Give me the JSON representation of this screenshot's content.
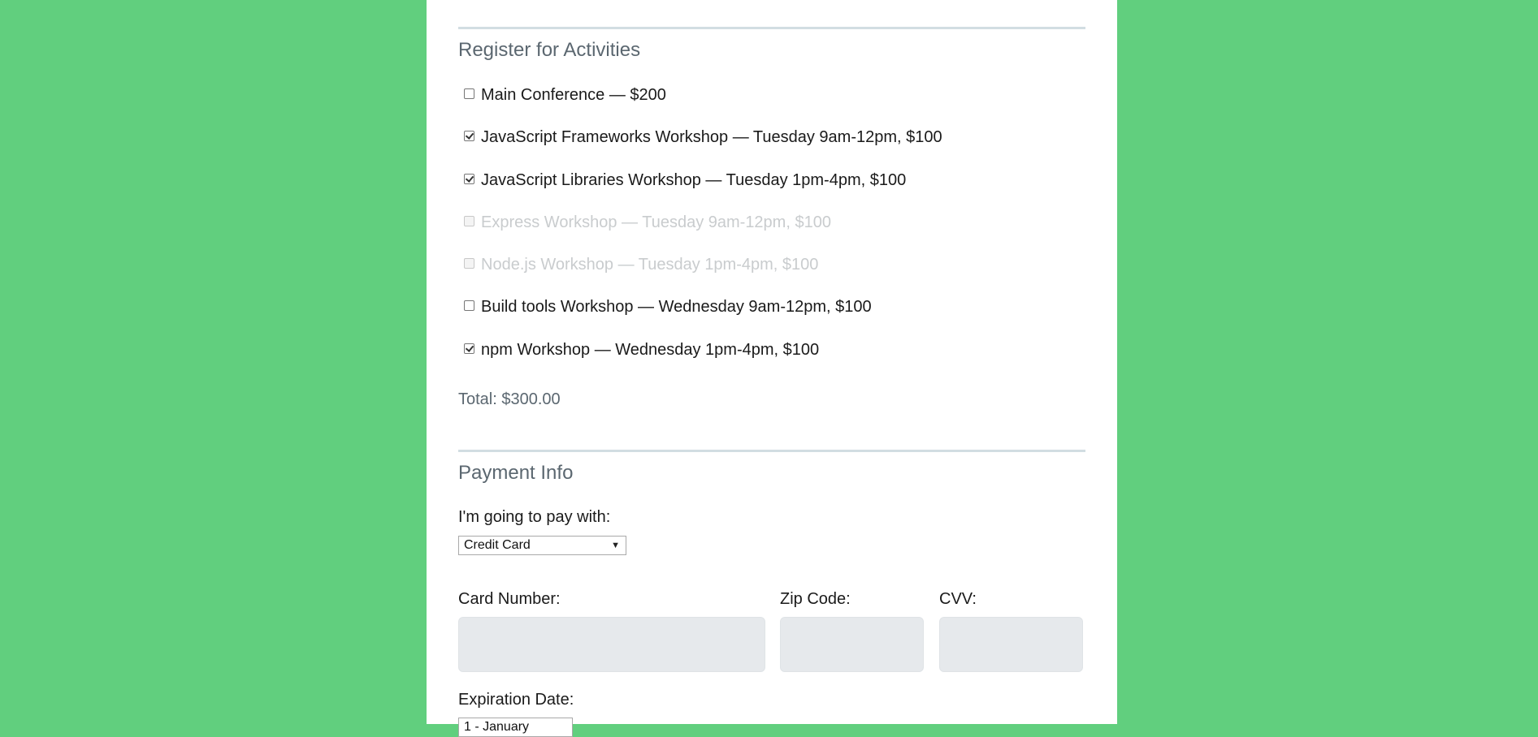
{
  "activities": {
    "legend": "Register for Activities",
    "items": [
      {
        "label": "Main Conference — $200",
        "checked": false,
        "disabled": false
      },
      {
        "label": "JavaScript Frameworks Workshop — Tuesday 9am-12pm, $100",
        "checked": true,
        "disabled": false
      },
      {
        "label": "JavaScript Libraries Workshop — Tuesday 1pm-4pm, $100",
        "checked": true,
        "disabled": false
      },
      {
        "label": "Express Workshop — Tuesday 9am-12pm, $100",
        "checked": false,
        "disabled": true
      },
      {
        "label": "Node.js Workshop — Tuesday 1pm-4pm, $100",
        "checked": false,
        "disabled": true
      },
      {
        "label": "Build tools Workshop — Wednesday 9am-12pm, $100",
        "checked": false,
        "disabled": false
      },
      {
        "label": "npm Workshop — Wednesday 1pm-4pm, $100",
        "checked": true,
        "disabled": false
      }
    ],
    "total": "Total: $300.00"
  },
  "payment": {
    "legend": "Payment Info",
    "method_label": "I'm going to pay with:",
    "method_value": "Credit Card",
    "card_number_label": "Card Number:",
    "card_number_value": "",
    "zip_label": "Zip Code:",
    "zip_value": "",
    "cvv_label": "CVV:",
    "cvv_value": "",
    "expiration_label": "Expiration Date:",
    "expiration_month_value": "1 - January"
  },
  "colors": {
    "page_background": "#61cf7e",
    "panel_background": "#ffffff",
    "legend_text": "#5b6770",
    "input_background": "#e6e9ec",
    "rule": "#d2dde2"
  }
}
